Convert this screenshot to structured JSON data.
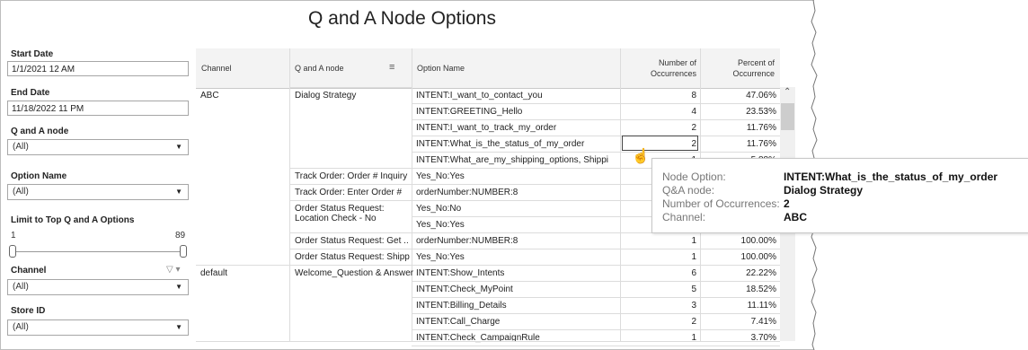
{
  "title": "Q and A Node Options",
  "filters": {
    "start_date_label": "Start Date",
    "start_date_value": "1/1/2021 12 AM",
    "end_date_label": "End Date",
    "end_date_value": "11/18/2022 11 PM",
    "qa_node_label": "Q and A node",
    "qa_node_value": "(All)",
    "option_name_label": "Option Name",
    "option_name_value": "(All)",
    "limit_label": "Limit to Top Q and A Options",
    "limit_min": "1",
    "limit_max": "89",
    "channel_label": "Channel",
    "channel_value": "(All)",
    "store_label": "Store ID",
    "store_value": "(All)"
  },
  "table": {
    "headers": [
      "Channel",
      "Q and A node",
      "Option Name",
      "Number of",
      "Occurrences",
      "Percent of",
      "Occurrence"
    ],
    "rows": [
      {
        "channel": "ABC",
        "node": "Dialog Strategy",
        "option": "INTENT:I_want_to_contact_you",
        "count": "8",
        "pct": "47.06%"
      },
      {
        "channel": "",
        "node": "",
        "option": "INTENT:GREETING_Hello",
        "count": "4",
        "pct": "23.53%"
      },
      {
        "channel": "",
        "node": "",
        "option": "INTENT:I_want_to_track_my_order",
        "count": "2",
        "pct": "11.76%"
      },
      {
        "channel": "",
        "node": "",
        "option": "INTENT:What_is_the_status_of_my_order",
        "count": "2",
        "pct": "11.76%"
      },
      {
        "channel": "",
        "node": "",
        "option": "INTENT:What_are_my_shipping_options, Shippi",
        "count": "1",
        "pct": "5.88%"
      },
      {
        "channel": "",
        "node": "Track Order: Order # Inquiry",
        "option": "Yes_No:Yes",
        "count": "",
        "pct": ""
      },
      {
        "channel": "",
        "node": "Track Order: Enter Order #",
        "option": "orderNumber:NUMBER:8",
        "count": "",
        "pct": ""
      },
      {
        "channel": "",
        "node": "Order Status Request: Location Check - No",
        "option": "Yes_No:No",
        "count": "",
        "pct": ""
      },
      {
        "channel": "",
        "node": "",
        "option": "Yes_No:Yes",
        "count": "",
        "pct": ""
      },
      {
        "channel": "",
        "node": "Order Status Request: Get ..",
        "option": "orderNumber:NUMBER:8",
        "count": "1",
        "pct": "100.00%"
      },
      {
        "channel": "",
        "node": "Order Status Request: Shipp",
        "option": "Yes_No:Yes",
        "count": "1",
        "pct": "100.00%"
      },
      {
        "channel": "default",
        "node": "Welcome_Question & Answer",
        "option": "INTENT:Show_Intents",
        "count": "6",
        "pct": "22.22%"
      },
      {
        "channel": "",
        "node": "",
        "option": "INTENT:Check_MyPoint",
        "count": "5",
        "pct": "18.52%"
      },
      {
        "channel": "",
        "node": "",
        "option": "INTENT:Billing_Details",
        "count": "3",
        "pct": "11.11%"
      },
      {
        "channel": "",
        "node": "",
        "option": "INTENT:Call_Charge",
        "count": "2",
        "pct": "7.41%"
      },
      {
        "channel": "",
        "node": "",
        "option": "INTENT:Check_CampaignRule",
        "count": "1",
        "pct": "3.70%"
      }
    ]
  },
  "tooltip": {
    "k1": "Node Option:",
    "v1": "INTENT:What_is_the_status_of_my_order",
    "k2": "Q&A node:",
    "v2": "Dialog Strategy",
    "k3": "Number of Occurrences:",
    "v3": "2",
    "k4": "Channel:",
    "v4": "ABC"
  }
}
